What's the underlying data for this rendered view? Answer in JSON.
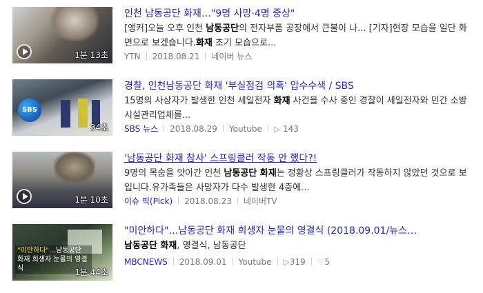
{
  "results": [
    {
      "title": "인천 남동공단 화재…\"9명 사망·4명 중상\"",
      "desc_parts": [
        {
          "t": "[앵커]오늘 오후 인천 ",
          "b": false
        },
        {
          "t": "남동공단",
          "b": true
        },
        {
          "t": "의 전자부품 공장에서 큰불이 나... [기자]현장 모습을 일단 화면으로 보겠습니다.",
          "b": false
        },
        {
          "t": "화재",
          "b": true
        },
        {
          "t": " 초기 모습으로...",
          "b": false
        }
      ],
      "source": "YTN",
      "date": "2018.08.21",
      "platform": "네이버 뉴스",
      "duration": "1분 13초",
      "thumb_icon": "play-icon"
    },
    {
      "title": "경찰, 인천남동공단 화재 '부실점검 의혹' 압수수색 / SBS",
      "desc_parts": [
        {
          "t": "15명의 사상자가 발생한 인천 세일전자 ",
          "b": false
        },
        {
          "t": "화재",
          "b": true
        },
        {
          "t": " 사건을 수사 중인 경찰이 세일전자와 민간 소방시설관리업체를...",
          "b": false
        }
      ],
      "source": "SBS 뉴스",
      "date": "2018.08.29",
      "platform": "Youtube",
      "views": "143",
      "duration": "34초",
      "logo_text": "SBS"
    },
    {
      "title": "'남동공단 화재 참사' 스프링클러 작동 안 했다?!",
      "desc_parts": [
        {
          "t": "9명의 목숨을 앗아간 인천 ",
          "b": false
        },
        {
          "t": "남동공단 화재",
          "b": true
        },
        {
          "t": "는 정황상 스프링클러가 작동하지 않았던 것으로 보입니다.유가족들은 사망자가 다수 발생한 4층에...",
          "b": false
        }
      ],
      "source": "이슈 픽(Pick)",
      "date": "2018.08.23",
      "platform": "네이버TV",
      "duration": "1분 10초"
    },
    {
      "title": "\"미안하다\"…남동공단 화재 희생자 눈물의 영결식 (2018.09.01/뉴스…",
      "tags": [
        "남동공단 화재",
        "영결식",
        "남동공단"
      ],
      "source": "MBCNEWS",
      "date": "2018.09.01",
      "platform": "Youtube",
      "views": "319",
      "likes": "5",
      "duration": "1분 44초",
      "caption_hl": "\"미안하다\"",
      "caption_rest": "…남동공단 화재 희생자 눈물의 영결식"
    }
  ],
  "colors": {
    "link": "#2127c9",
    "meta": "#777777",
    "text": "#333333"
  }
}
